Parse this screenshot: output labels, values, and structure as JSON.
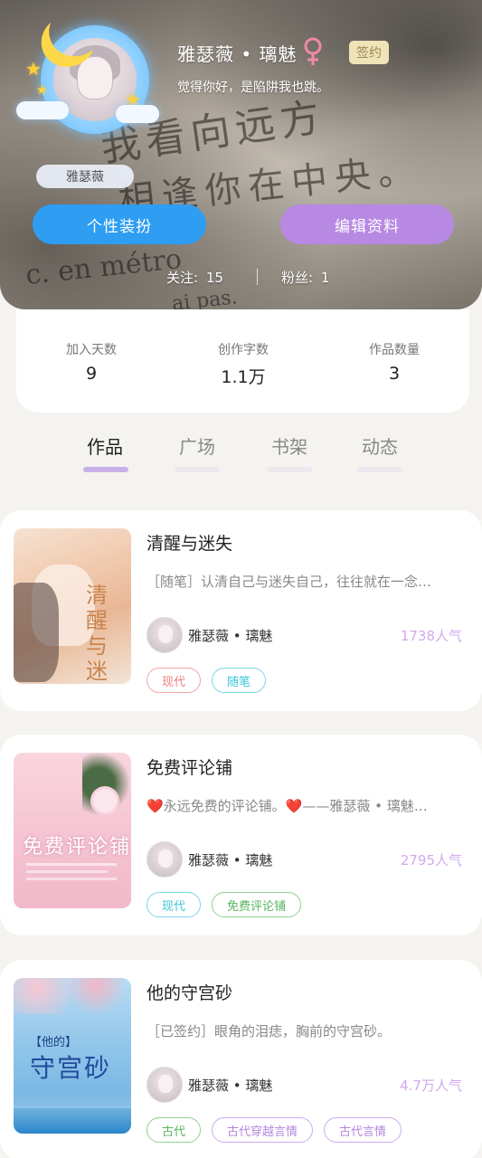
{
  "profile": {
    "nickname_tag": "雅瑟薇",
    "display_name": "雅瑟薇 • 璃魅",
    "sign_badge": "签约",
    "motto": "觉得你好，是陷阱我也跳。",
    "buttons": {
      "dress_up": "个性装扮",
      "edit_profile": "编辑资料"
    },
    "follow_label": "关注:",
    "follow_count": "15",
    "fans_label": "粉丝:",
    "fans_count": "1"
  },
  "stats": [
    {
      "label": "加入天数",
      "value": "9"
    },
    {
      "label": "创作字数",
      "value": "1.1万"
    },
    {
      "label": "作品数量",
      "value": "3"
    }
  ],
  "tabs": [
    "作品",
    "广场",
    "书架",
    "动态"
  ],
  "works": [
    {
      "title": "清醒与迷失",
      "desc": "［随笔］认清自己与迷失自己，往往就在一念…",
      "author": "雅瑟薇 • 璃魅",
      "popularity": "1738人气",
      "tags": [
        "现代",
        "随笔"
      ],
      "cover_text": "清醒与迷失"
    },
    {
      "title": "免费评论铺",
      "desc": "❤️永远免费的评论铺。❤️——雅瑟薇 • 璃魅…",
      "author": "雅瑟薇 • 璃魅",
      "popularity": "2795人气",
      "tags": [
        "现代",
        "免费评论铺"
      ],
      "cover_text": "免费评论铺"
    },
    {
      "title": "他的守宫砂",
      "desc": "［已签约］眼角的泪痣，胸前的守宫砂。",
      "author": "雅瑟薇 • 璃魅",
      "popularity": "4.7万人气",
      "tags": [
        "古代",
        "古代穿越言情",
        "古代言情"
      ],
      "cover_text": "守宫砂",
      "cover_text_small": "【他的】"
    }
  ],
  "colors": {
    "dress_button": "#2e9df2",
    "edit_button": "#b789e3",
    "popularity": "#d2a9ec",
    "active_tab_bar": "#c9b0e9"
  }
}
